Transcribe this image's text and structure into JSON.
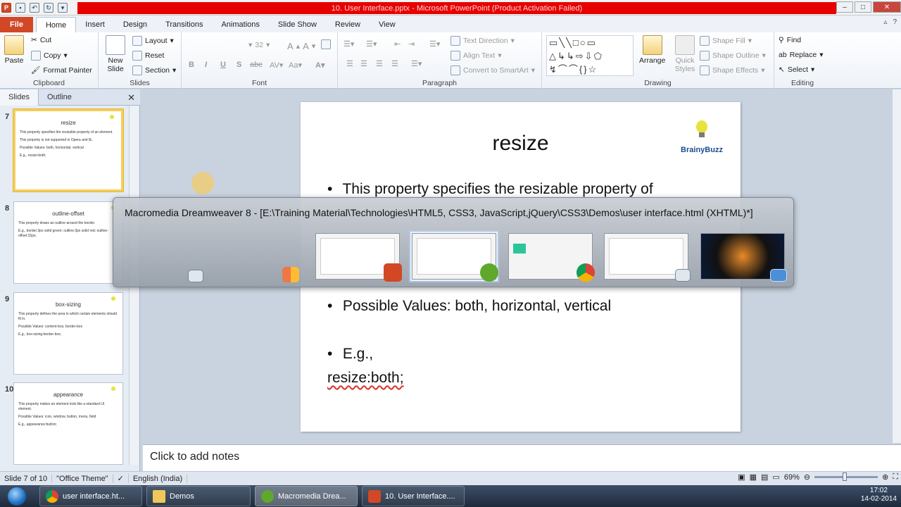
{
  "window": {
    "title": "10. User Interface.pptx  -  Microsoft PowerPoint (Product Activation Failed)",
    "app_icon": "P"
  },
  "tabs": [
    "File",
    "Home",
    "Insert",
    "Design",
    "Transitions",
    "Animations",
    "Slide Show",
    "Review",
    "View"
  ],
  "ribbon": {
    "clipboard": {
      "paste": "Paste",
      "cut": "Cut",
      "copy": "Copy",
      "format_painter": "Format Painter",
      "label": "Clipboard"
    },
    "slides": {
      "new_slide": "New Slide",
      "layout": "Layout",
      "reset": "Reset",
      "section": "Section",
      "label": "Slides"
    },
    "font": {
      "size": "32",
      "label": "Font"
    },
    "paragraph": {
      "text_direction": "Text Direction",
      "align_text": "Align Text",
      "smartart": "Convert to SmartArt",
      "label": "Paragraph"
    },
    "drawing": {
      "arrange": "Arrange",
      "quick_styles": "Quick Styles",
      "shape_fill": "Shape Fill",
      "shape_outline": "Shape Outline",
      "shape_effects": "Shape Effects",
      "label": "Drawing"
    },
    "editing": {
      "find": "Find",
      "replace": "Replace",
      "select": "Select",
      "label": "Editing"
    }
  },
  "panel": {
    "tabs": [
      "Slides",
      "Outline"
    ],
    "thumbs": [
      {
        "num": "7",
        "title": "resize",
        "bullets": [
          "This property specifies the resizable property of an element.",
          "This property is not supported in Opera and IE.",
          "Possible Values: both, horizontal, vertical",
          "E.g., resize:both;"
        ]
      },
      {
        "num": "8",
        "title": "outline-offset",
        "bullets": [
          "This property draws an outline around the border.",
          "E.g., border:3px solid green; outline:3px solid red; outline-offset:15px;"
        ]
      },
      {
        "num": "9",
        "title": "box-sizing",
        "bullets": [
          "This property defines the area in which certain elements should fit in.",
          "Possible Values: content-box, border-box",
          "E.g., box-sizing:border-box;"
        ]
      },
      {
        "num": "10",
        "title": "appearance",
        "bullets": [
          "This property makes an element look like a standard UI element.",
          "Possible Values: icon, window, button, menu, field",
          "E.g., appearance:button;"
        ]
      }
    ]
  },
  "slide": {
    "title": "resize",
    "bullet1": "This property specifies the resizable property of",
    "bullet2": "Possible Values: both, horizontal, vertical",
    "bullet3": "E.g.,",
    "code": "resize:both;",
    "logo_text": "BrainyBuzz"
  },
  "switcher": {
    "title": "Macromedia Dreamweaver 8 - [E:\\Training Material\\Technologies\\HTML5, CSS3, JavaScript,jQuery\\CSS3\\Demos\\user interface.html (XHTML)*]"
  },
  "notes": {
    "placeholder": "Click to add notes"
  },
  "status": {
    "slide": "Slide 7 of 10",
    "theme": "\"Office Theme\"",
    "language": "English (India)",
    "zoom": "69%"
  },
  "taskbar": {
    "items": [
      "user interface.ht...",
      "Demos",
      "Macromedia Drea...",
      "10. User Interface...."
    ],
    "time": "17:02",
    "date": "14-02-2014"
  },
  "colors": {
    "accent_file": "#d24726",
    "title_alert": "#e60000",
    "thumb_selected": "#f4cf5a"
  }
}
